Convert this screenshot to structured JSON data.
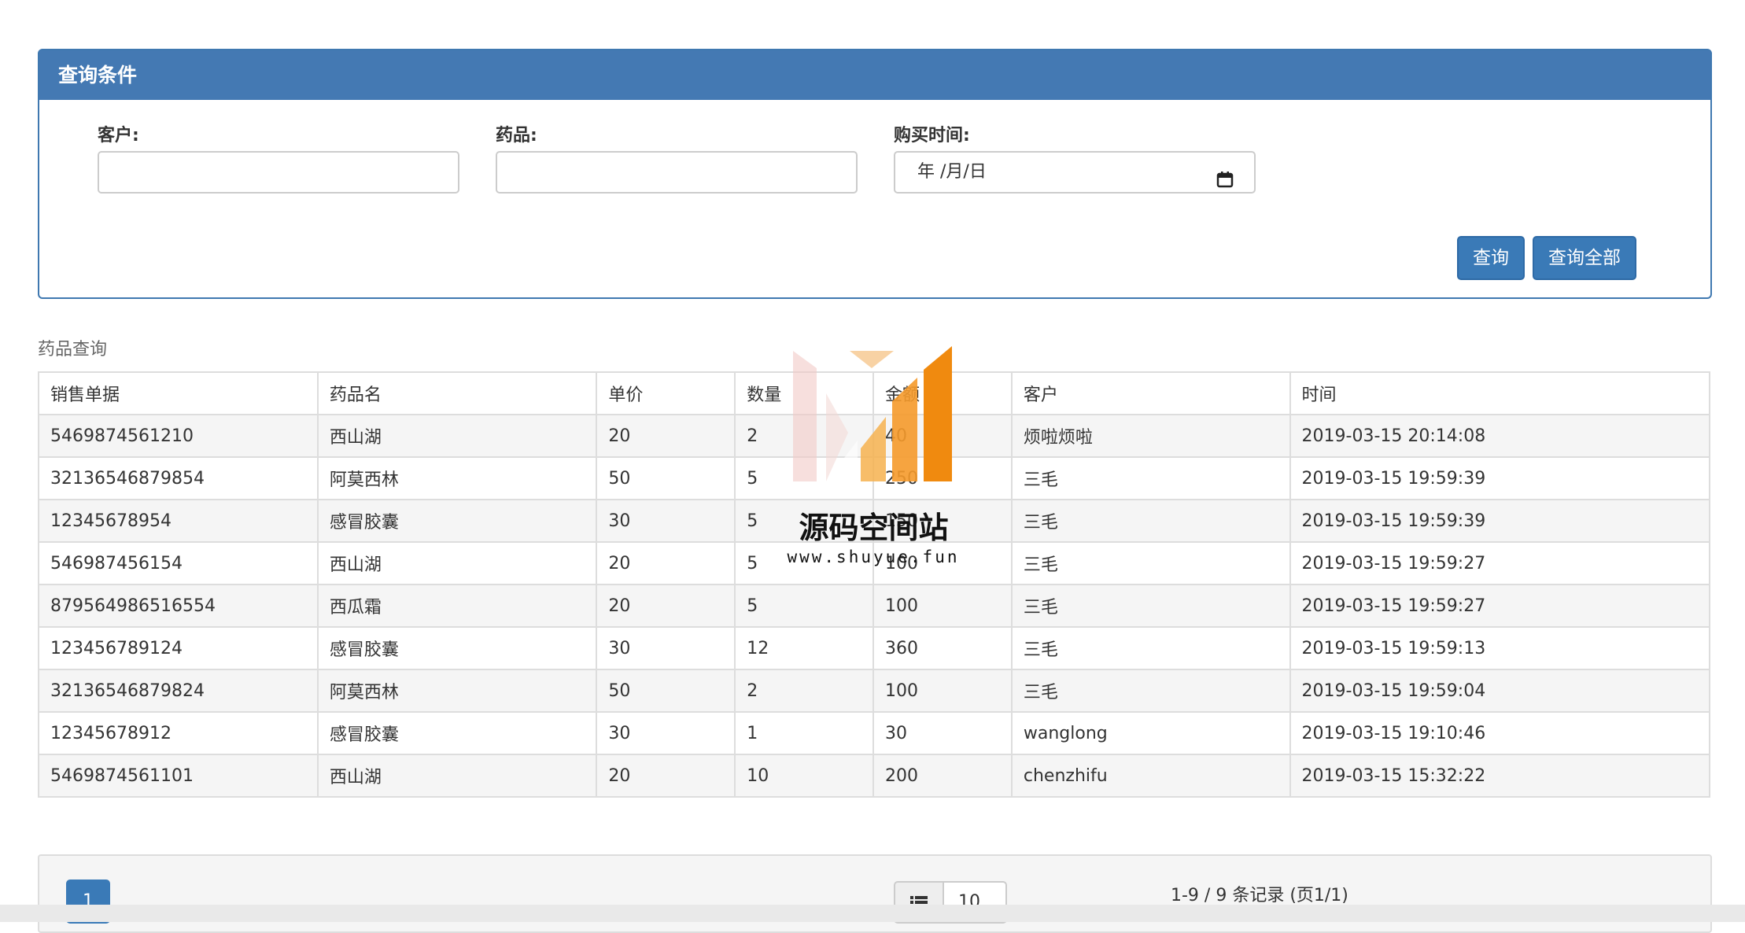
{
  "panel": {
    "title": "查询条件",
    "customer_label": "客户:",
    "customer_value": "",
    "drug_label": "药品:",
    "drug_value": "",
    "time_label": "购买时间:",
    "date_placeholder": "年 /月/日",
    "query_button": "查询",
    "query_all_button": "查询全部"
  },
  "table": {
    "title": "药品查询",
    "headers": [
      "销售单据",
      "药品名",
      "单价",
      "数量",
      "金额",
      "客户",
      "时间"
    ],
    "rows": [
      [
        "5469874561210",
        "西山湖",
        "20",
        "2",
        "40",
        "烦啦烦啦",
        "2019-03-15 20:14:08"
      ],
      [
        "32136546879854",
        "阿莫西林",
        "50",
        "5",
        "250",
        "三毛",
        "2019-03-15 19:59:39"
      ],
      [
        "12345678954",
        "感冒胶囊",
        "30",
        "5",
        "150",
        "三毛",
        "2019-03-15 19:59:39"
      ],
      [
        "546987456154",
        "西山湖",
        "20",
        "5",
        "100",
        "三毛",
        "2019-03-15 19:59:27"
      ],
      [
        "879564986516554",
        "西瓜霜",
        "20",
        "5",
        "100",
        "三毛",
        "2019-03-15 19:59:27"
      ],
      [
        "123456789124",
        "感冒胶囊",
        "30",
        "12",
        "360",
        "三毛",
        "2019-03-15 19:59:13"
      ],
      [
        "32136546879824",
        "阿莫西林",
        "50",
        "2",
        "100",
        "三毛",
        "2019-03-15 19:59:04"
      ],
      [
        "12345678912",
        "感冒胶囊",
        "30",
        "1",
        "30",
        "wanglong",
        "2019-03-15 19:10:46"
      ],
      [
        "5469874561101",
        "西山湖",
        "20",
        "10",
        "200",
        "chenzhifu",
        "2019-03-15 15:32:22"
      ]
    ]
  },
  "watermark": {
    "text": "源码空间站",
    "url": "www.shuyue.fun"
  },
  "pager": {
    "current_page": "1",
    "page_size": "10",
    "info": "1-9 / 9 条记录 (页1/1)"
  },
  "colors": {
    "accent": "#4479b3",
    "button": "#3a7ab7"
  },
  "icons": {
    "calendar": "calendar-icon",
    "list": "list-icon"
  }
}
